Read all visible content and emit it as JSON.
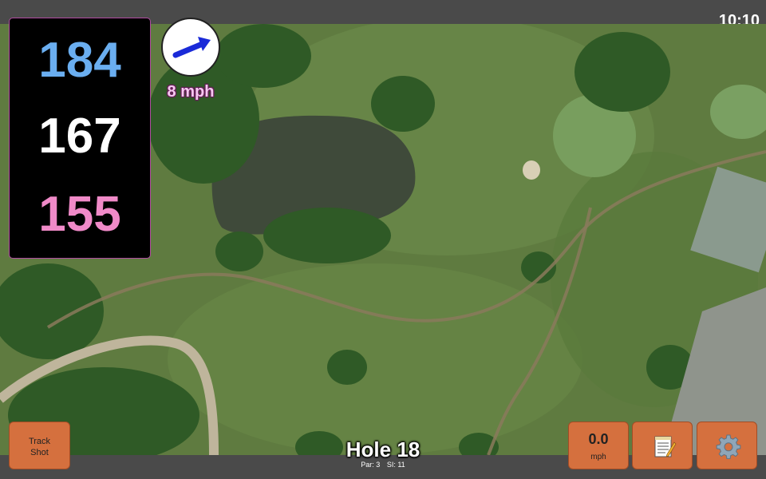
{
  "status_bar": {
    "clock": "10:10"
  },
  "distances": {
    "back": "184",
    "middle": "167",
    "front": "155"
  },
  "wind": {
    "speed": "8 mph",
    "direction_icon": "arrow-icon"
  },
  "track_shot_button": {
    "label_line1": "Track",
    "label_line2": "Shot"
  },
  "speed_button": {
    "value": "0.0",
    "unit": "mph"
  },
  "notes_button": {
    "icon": "notepad-icon"
  },
  "settings_button": {
    "icon": "gear-icon"
  },
  "hole": {
    "title": "Hole 18",
    "par": "Par: 3",
    "si": "SI: 11"
  },
  "colors": {
    "distance_back": "#6aaef0",
    "distance_middle": "#ffffff",
    "distance_front": "#f08ac8",
    "button_bg": "#d5703e",
    "panel_border": "#b04aa0",
    "wind_arrow": "#1a2ad8"
  }
}
